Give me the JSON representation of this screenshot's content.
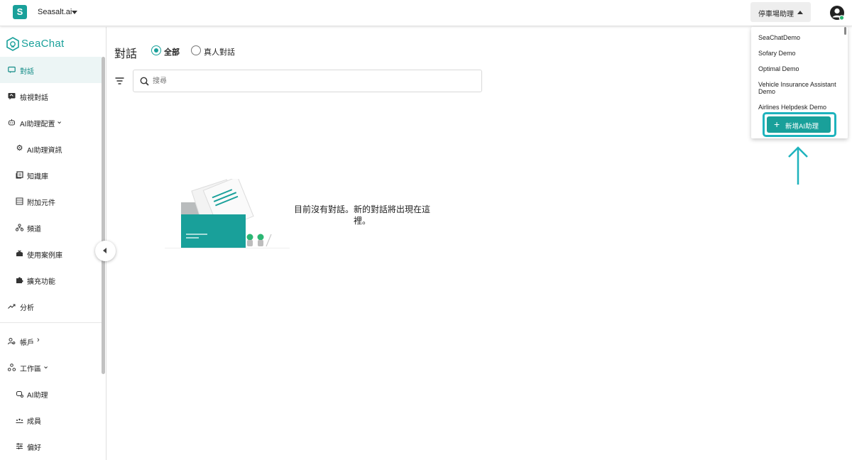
{
  "topbar": {
    "org_badge": "S",
    "org_name": "Seasalt.ai",
    "assistant_selector": "停車場助理"
  },
  "sidebar": {
    "logo": "SeaChat",
    "items": [
      {
        "label": "對話",
        "icon": "chat-icon",
        "active": true
      },
      {
        "label": "檢視對話",
        "icon": "review-chat-icon"
      },
      {
        "label": "AI助理配置",
        "icon": "robot-icon"
      },
      {
        "label": "AI助理資訊",
        "icon": "gear-icon"
      },
      {
        "label": "知識庫",
        "icon": "book-icon"
      },
      {
        "label": "附加元件",
        "icon": "addon-icon"
      },
      {
        "label": "頻道",
        "icon": "channel-icon"
      },
      {
        "label": "使用案例庫",
        "icon": "box-icon"
      },
      {
        "label": "擴充功能",
        "icon": "puzzle-icon"
      },
      {
        "label": "分析",
        "icon": "trend-icon"
      },
      {
        "label": "帳戶",
        "icon": "account-icon"
      },
      {
        "label": "工作區",
        "icon": "workspace-icon"
      },
      {
        "label": "AI助理",
        "icon": "assistant-icon"
      },
      {
        "label": "成員",
        "icon": "members-icon"
      },
      {
        "label": "偏好",
        "icon": "sliders-icon"
      }
    ]
  },
  "main": {
    "title": "對話",
    "filter_all": "全部",
    "filter_human": "真人對話",
    "search_placeholder": "搜尋",
    "empty_message": "目前沒有對話。新的對話將出現在這裡。"
  },
  "dropdown": {
    "items": [
      "SeaChatDemo",
      "Sofary Demo",
      "Optimal Demo",
      "Vehicle Insurance Assistant Demo",
      "Airlines Helpdesk Demo"
    ],
    "add_button": "新增AI助理"
  },
  "colors": {
    "brand": "#19a09a",
    "highlight": "#1eb3bd"
  }
}
